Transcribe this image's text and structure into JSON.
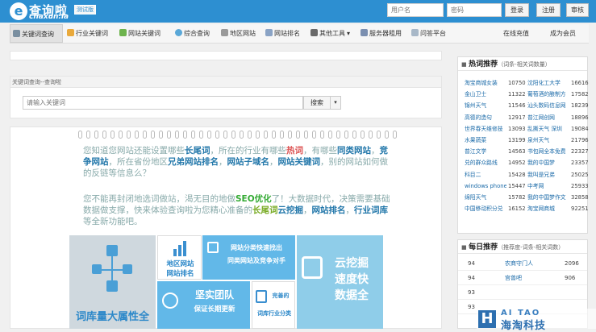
{
  "brand": {
    "logo_letter": "e",
    "name": "查询啦",
    "domain": "chaxun.la",
    "badge": "测试版"
  },
  "auth": {
    "username_placeholder": "用户名",
    "password_placeholder": "密码",
    "login": "登录",
    "register": "注册",
    "audit": "审核"
  },
  "nav": {
    "items": [
      "关键词查询",
      "行业关键词",
      "网站关键词",
      "综合查询",
      "地区网站",
      "网站排名",
      "其他工具",
      "服务器租用",
      "问答平台"
    ],
    "right": [
      "在线充值",
      "成为会员"
    ]
  },
  "search": {
    "header": "关键词查询--查询啦",
    "placeholder": "请输入关键词",
    "button": "搜索",
    "dropdown": "▾"
  },
  "promo": {
    "p1": [
      {
        "t": "您知道"
      },
      {
        "t": "您网站还能设置哪些"
      },
      {
        "t": "长尾词",
        "c": "hl"
      },
      {
        "t": "，所在的行业有哪些"
      },
      {
        "t": "热词",
        "c": "hr"
      },
      {
        "t": "，有哪些"
      },
      {
        "t": "同类网站",
        "c": "hl"
      },
      {
        "t": "，"
      },
      {
        "t": "竞争网站",
        "c": "hl"
      },
      {
        "t": "，所在省份地区"
      },
      {
        "t": "兄弟网站排名",
        "c": "hl"
      },
      {
        "t": "，"
      },
      {
        "t": "网站子域名",
        "c": "hl"
      },
      {
        "t": "，"
      },
      {
        "t": "网站关键词",
        "c": "hl"
      },
      {
        "t": "，别的网站如何做的反链等信息么？"
      }
    ],
    "p2": [
      {
        "t": "您不能再封闭地选词做站，渴无目的地做"
      },
      {
        "t": "SEO优化",
        "c": "hy"
      },
      {
        "t": "了！大数据时代，决策需要基础数据做支撑，快来体验查询啦为您精心准备的"
      },
      {
        "t": "长尾词",
        "c": "hg"
      },
      {
        "t": "云挖掘",
        "c": "hl"
      },
      {
        "t": "，"
      },
      {
        "t": "网站排名",
        "c": "hl"
      },
      {
        "t": "，"
      },
      {
        "t": "行业词库",
        "c": "hl"
      },
      {
        "t": "等全新功能吧。"
      }
    ],
    "tiles": {
      "t1": "词库量大属性全",
      "t2a": "地区网站",
      "t2b": "网站排名",
      "t3a": "网站分类快速找出",
      "t3b": "同类网站及竞争对手",
      "t4a": "坚实团队",
      "t4b": "保证长期更新",
      "t5a": "完善的",
      "t5b": "词库行业分类",
      "t6a": "云挖掘",
      "t6b": "速度快",
      "t6c": "数据全"
    }
  },
  "hot": {
    "title": "热词推荐",
    "subtitle": "（词条-相关词数量）",
    "rows": [
      [
        "淘宝商城女装",
        "10750",
        "沈阳化工大学",
        "16616"
      ],
      [
        "金山卫士",
        "11322",
        "葡萄酒的酿制方",
        "17582"
      ],
      [
        "锦州天气",
        "11546",
        "汕头数码信息网",
        "18239"
      ],
      [
        "高德的造句",
        "12917",
        "普江网创网",
        "18896"
      ],
      [
        "世界春天维修技",
        "13093",
        "乱撕天气 深圳",
        "19084"
      ],
      [
        "水果蔬菜",
        "13199",
        "泉州天气",
        "21796"
      ],
      [
        "普江文学",
        "14563",
        "书包网全本免费",
        "22327"
      ],
      [
        "兑的群众路线",
        "14952",
        "我的中国梦",
        "23357"
      ],
      [
        "科目二",
        "15428",
        "我叫是兄弟",
        "25025"
      ],
      [
        "windows phone",
        "15447",
        "中考网",
        "25933"
      ],
      [
        "绵阳天气",
        "15782",
        "我的中国梦作文",
        "32858"
      ],
      [
        "中国移动积分兑",
        "16152",
        "淘宝网商城",
        "92251"
      ]
    ]
  },
  "daily": {
    "title": "每日推荐",
    "subtitle": "（推荐度-词条-相关词数）",
    "rows": [
      [
        "94",
        "农商守门人",
        "2096"
      ],
      [
        "94",
        "宫兽吧",
        "906"
      ],
      [
        "93",
        "",
        ""
      ],
      [
        "93",
        "",
        ""
      ]
    ]
  },
  "watermark": {
    "letter": "H",
    "top": "AI TAO",
    "bottom": "海淘科技"
  }
}
